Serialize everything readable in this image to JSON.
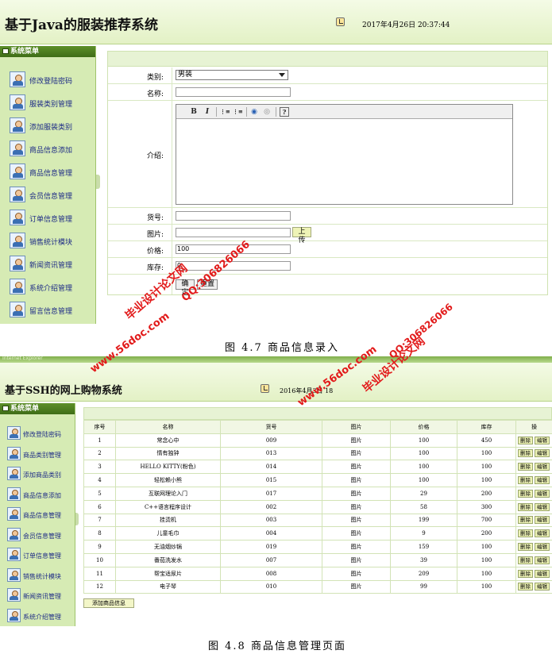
{
  "shot1": {
    "title": "基于Java的服装推荐系统",
    "datetime": "2017年4月26日  20:37:44",
    "menu_title": "系统菜单",
    "menu": [
      "修改登陆密码",
      "服装类别管理",
      "添加服装类别",
      "商品信息添加",
      "商品信息管理",
      "会员信息管理",
      "订单信息管理",
      "销售统计模块",
      "新闻资讯管理",
      "系统介绍管理",
      "留言信息管理"
    ],
    "form": {
      "category_label": "类别:",
      "category_value": "男装",
      "name_label": "名称:",
      "intro_label": "介绍:",
      "editor_tools": [
        "B",
        "I",
        "⋮≡",
        "⋮≡",
        "◉",
        "◎",
        "?"
      ],
      "code_label": "货号:",
      "image_label": "图片:",
      "upload_button": "上传",
      "price_label": "价格:",
      "price_value": "100",
      "stock_label": "库存:",
      "stock_value": "0",
      "submit_button": "确定",
      "reset_button": "重置"
    }
  },
  "caption1": "图 4.7 商品信息录入",
  "shot2": {
    "strip_text": "Internet Explorer",
    "title": "基于SSH的网上购物系统",
    "datetime": "2016年4月3日    18",
    "menu_title": "系统菜单",
    "menu": [
      "修改登陆密码",
      "商品类别管理",
      "添加商品类别",
      "商品信息添加",
      "商品信息管理",
      "会员信息管理",
      "订单信息管理",
      "销售统计模块",
      "新闻资讯管理",
      "系统介绍管理"
    ],
    "table": {
      "headers": [
        "序号",
        "名称",
        "货号",
        "图片",
        "价格",
        "库存",
        "操"
      ],
      "rows": [
        [
          "1",
          "常念心中",
          "009",
          "图片",
          "100",
          "450"
        ],
        [
          "2",
          "情有独钟",
          "013",
          "图片",
          "100",
          "100"
        ],
        [
          "3",
          "HELLO KITTY(粉色)",
          "014",
          "图片",
          "100",
          "100"
        ],
        [
          "4",
          "轻松赖小熊",
          "015",
          "图片",
          "100",
          "100"
        ],
        [
          "5",
          "互联网理论入门",
          "017",
          "图片",
          "29",
          "200"
        ],
        [
          "6",
          "C++语言程序设计",
          "002",
          "图片",
          "58",
          "300"
        ],
        [
          "7",
          "挂烫机",
          "003",
          "图片",
          "199",
          "700"
        ],
        [
          "8",
          "儿童毛巾",
          "004",
          "图片",
          "9",
          "200"
        ],
        [
          "9",
          "无油烟炒锅",
          "019",
          "图片",
          "159",
          "100"
        ],
        [
          "10",
          "番茄洗发水",
          "007",
          "图片",
          "39",
          "100"
        ],
        [
          "11",
          "帮宝适尿片",
          "008",
          "图片",
          "209",
          "100"
        ],
        [
          "12",
          "电子琴",
          "010",
          "图片",
          "99",
          "100"
        ]
      ],
      "delete_label": "删除",
      "edit_label": "编辑"
    },
    "add_button": "添加商品信息"
  },
  "caption2": "图 4.8 商品信息管理页面",
  "watermarks": [
    "毕业设计论文网",
    "QQ:306826066",
    "www.56doc.com",
    "QQ:306826066",
    "www.56doc.com",
    "毕业设计论文网"
  ],
  "colors": {
    "accent": "#3f6d17",
    "menu_bg": "#d6ebb4",
    "watermark": "#e21b1b"
  }
}
